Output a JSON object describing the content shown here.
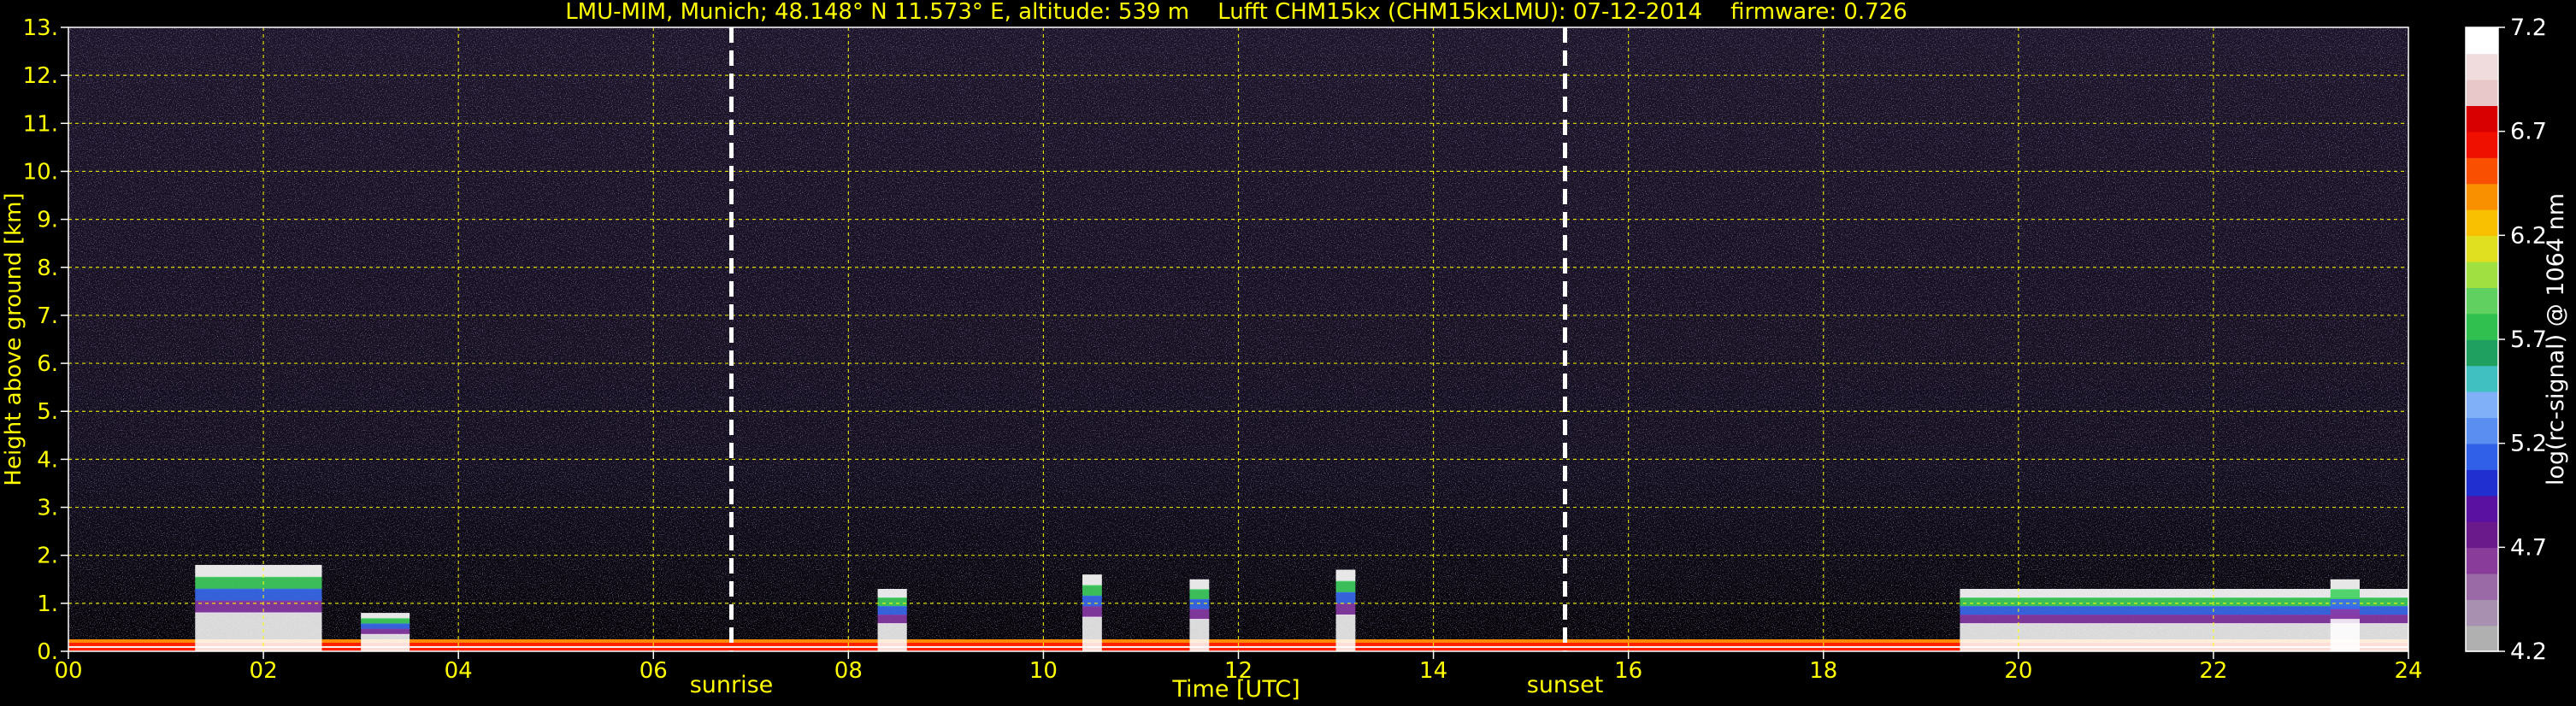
{
  "chart_data": {
    "type": "heatmap",
    "title": "LMU-MIM, Munich; 48.148° N 11.573° E, altitude: 539 m    Lufft CHM15kx (CHM15kxLMU): 07-12-2014    firmware: 0.726",
    "xlabel": "Time [UTC]",
    "ylabel": "Height above ground [km]",
    "xlim": [
      0,
      24
    ],
    "ylim": [
      0,
      13
    ],
    "x_ticks": [
      "00",
      "02",
      "04",
      "06",
      "08",
      "10",
      "12",
      "14",
      "16",
      "18",
      "20",
      "22",
      "24"
    ],
    "y_ticks": [
      "0.",
      "1.",
      "2.",
      "3.",
      "4.",
      "5.",
      "6.",
      "7.",
      "8.",
      "9.",
      "10.",
      "11.",
      "12.",
      "13."
    ],
    "grid": true,
    "annotations": [
      {
        "label": "sunrise",
        "time": 6.8
      },
      {
        "label": "sunset",
        "time": 15.35
      }
    ],
    "colorbar": {
      "label": "log(rc-signal) @ 1064 nm",
      "range": [
        4.2,
        7.2
      ],
      "ticks": [
        "4.2",
        "4.7",
        "5.2",
        "5.7",
        "6.2",
        "6.7",
        "7.2"
      ],
      "colors": [
        "#b0b0b0",
        "#a890b0",
        "#9a6aa6",
        "#8a3c9a",
        "#6a1a8a",
        "#5a10a0",
        "#2030d0",
        "#3060e8",
        "#5a8ef0",
        "#80b0f8",
        "#40c0c0",
        "#20a060",
        "#30c050",
        "#60d060",
        "#a0e040",
        "#e0e020",
        "#f8c000",
        "#f89000",
        "#f85000",
        "#f01000",
        "#d80000",
        "#e8c8c8",
        "#f0dcdc",
        "#ffffff"
      ]
    },
    "series": [
      {
        "values_description": [
          {
            "x": [
              0.0,
              24.0
            ],
            "y_top": 0.25,
            "level": "high"
          },
          {
            "x": [
              1.3,
              2.6
            ],
            "y_top": 1.8,
            "level": "mid"
          },
          {
            "x": [
              3.0,
              3.5
            ],
            "y_top": 0.8,
            "level": "mid"
          },
          {
            "x": [
              8.3,
              8.6
            ],
            "y_top": 1.3,
            "level": "mid"
          },
          {
            "x": [
              10.4,
              10.6
            ],
            "y_top": 1.6,
            "level": "mid"
          },
          {
            "x": [
              11.5,
              11.7
            ],
            "y_top": 1.5,
            "level": "mid"
          },
          {
            "x": [
              13.0,
              13.2
            ],
            "y_top": 1.7,
            "level": "mid"
          },
          {
            "x": [
              19.4,
              24.0
            ],
            "y_top": 1.3,
            "level": "mid"
          },
          {
            "x": [
              23.2,
              23.5
            ],
            "y_top": 1.5,
            "level": "mid"
          }
        ]
      }
    ],
    "colors": {
      "text": "#ffff00",
      "grid": "#ffff00",
      "background": "#000000",
      "marker_line": "#ffffff"
    }
  }
}
